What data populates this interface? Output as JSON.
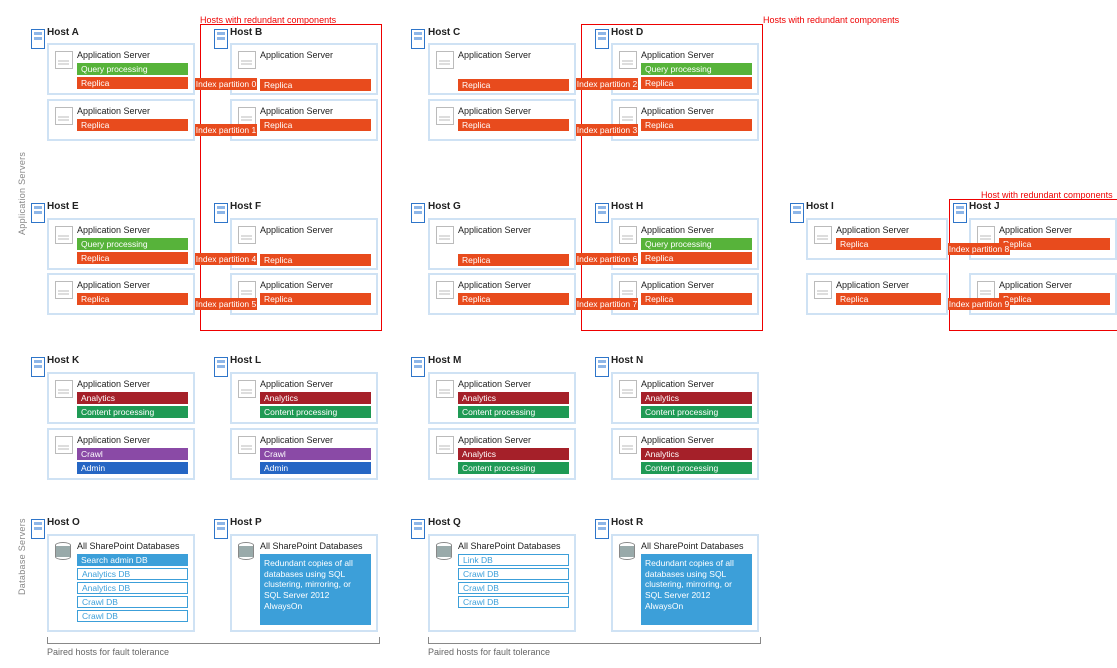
{
  "section": {
    "app": "Application Servers",
    "db": "Database Servers"
  },
  "redundant": {
    "plural": "Hosts with redundant components",
    "single": "Host with redundant components"
  },
  "pairnote": "Paired hosts for fault tolerance",
  "labels": {
    "appserver": "Application Server",
    "allsp": "All SharePoint Databases"
  },
  "hosts": {
    "A": "Host A",
    "B": "Host B",
    "C": "Host C",
    "D": "Host D",
    "E": "Host E",
    "F": "Host F",
    "G": "Host G",
    "H": "Host H",
    "I": "Host I",
    "J": "Host J",
    "K": "Host K",
    "L": "Host L",
    "M": "Host M",
    "N": "Host N",
    "O": "Host O",
    "P": "Host P",
    "Q": "Host Q",
    "R": "Host R"
  },
  "comp": {
    "query": "Query processing",
    "replica": "Replica",
    "analytics": "Analytics",
    "content": "Content processing",
    "crawl": "Crawl",
    "admin": "Admin"
  },
  "idxp": {
    "0": "Index partition 0",
    "1": "Index partition 1",
    "2": "Index partition 2",
    "3": "Index partition 3",
    "4": "Index partition 4",
    "5": "Index partition 5",
    "6": "Index partition 6",
    "7": "Index partition 7",
    "8": "Index partition 8",
    "9": "Index partition 9"
  },
  "dbs": {
    "search": "Search admin DB",
    "analytics": "Analytics DB",
    "crawlDB": "Crawl DB",
    "link": "Link DB"
  },
  "redundantText": "Redundant copies of all databases using SQL clustering, mirroring, or SQL Server 2012 AlwaysOn"
}
